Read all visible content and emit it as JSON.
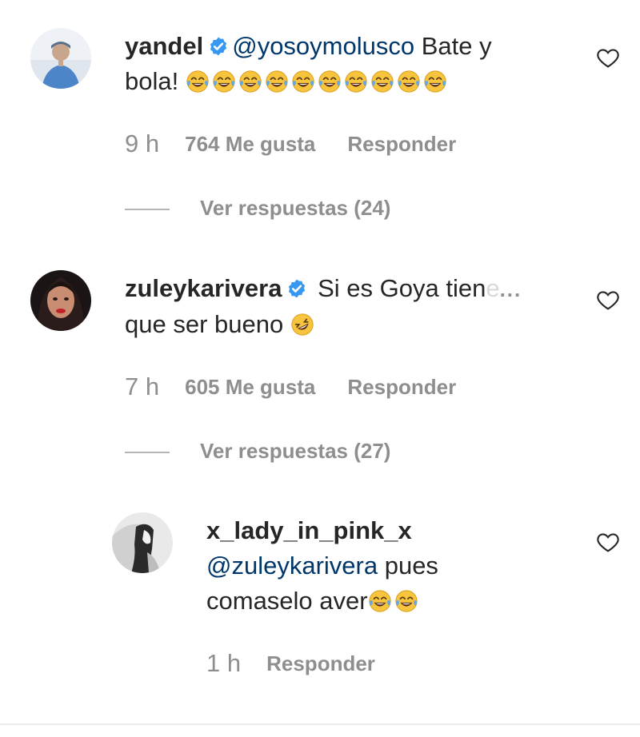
{
  "comments": [
    {
      "username": "yandel",
      "verified": true,
      "mention": "@yosoymolusco",
      "text_part1": " Bate y",
      "text_part2": "bola!",
      "emoji_count": 10,
      "time": "9 h",
      "likes": "764 Me gusta",
      "reply_label": "Responder",
      "view_replies": "Ver respuestas (24)",
      "avatar_icon": "yandel-avatar"
    },
    {
      "username": "zuleykarivera",
      "verified": true,
      "text_part1": " Si es Goya tien",
      "text_fade": "e",
      "more": "...",
      "text_part2": "que ser bueno",
      "emoji": "rolling-on-floor-laughing",
      "time": "7 h",
      "likes": "605 Me gusta",
      "reply_label": "Responder",
      "view_replies": "Ver respuestas (27)",
      "avatar_icon": "zuleyka-avatar"
    }
  ],
  "reply": {
    "username": "x_lady_in_pink_x",
    "mention": "@zuleykarivera",
    "text_part1": " pues",
    "text_part2": "comaselo aver",
    "emoji_count": 2,
    "time": "1 h",
    "reply_label": "Responder",
    "avatar_icon": "lady-avatar"
  },
  "colors": {
    "text": "#262626",
    "meta": "#8e8e8e",
    "mention": "#00376b",
    "verified": "#3897f0"
  }
}
